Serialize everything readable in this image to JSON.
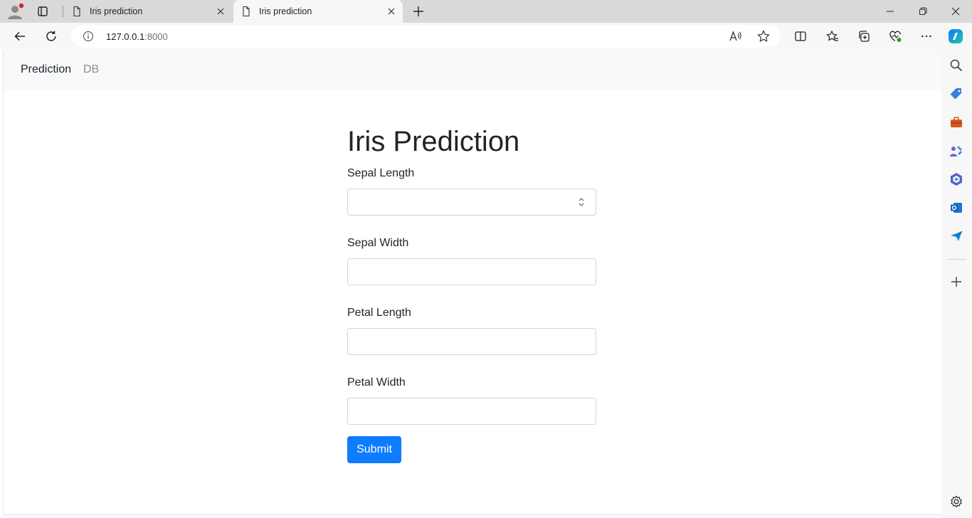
{
  "browser": {
    "tabs": [
      {
        "title": "Iris prediction",
        "active": false
      },
      {
        "title": "Iris prediction",
        "active": true
      }
    ],
    "address": {
      "host": "127.0.0.1",
      "port": ":8000"
    }
  },
  "navbar": {
    "links": [
      {
        "label": "Prediction",
        "active": true
      },
      {
        "label": "DB",
        "active": false
      }
    ]
  },
  "form": {
    "title": "Iris Prediction",
    "fields": [
      {
        "label": "Sepal Length",
        "value": "",
        "type": "number"
      },
      {
        "label": "Sepal Width",
        "value": ""
      },
      {
        "label": "Petal Length",
        "value": ""
      },
      {
        "label": "Petal Width",
        "value": ""
      }
    ],
    "submit_label": "Submit"
  },
  "colors": {
    "primary": "#0d7cff",
    "navbar_bg": "#f8f9fa",
    "text": "#212529",
    "muted": "#8a8d90",
    "input_border": "#ced4da"
  },
  "icons": {
    "browser": [
      "profile-icon",
      "tab-actions-icon",
      "document-icon",
      "close-icon",
      "new-tab-icon",
      "minimize-icon",
      "restore-icon",
      "window-close-icon",
      "back-icon",
      "refresh-icon",
      "info-icon",
      "read-aloud-icon",
      "favorite-star-icon",
      "split-screen-icon",
      "favorites-icon",
      "collections-icon",
      "browser-essentials-icon",
      "more-icon",
      "copilot-icon"
    ],
    "sidebar": [
      "search-icon",
      "shopping-tag-icon",
      "tools-icon",
      "games-icon",
      "microsoft-365-icon",
      "outlook-icon",
      "send-icon",
      "add-icon",
      "settings-icon"
    ]
  }
}
